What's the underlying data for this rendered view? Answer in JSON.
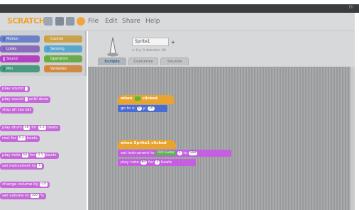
{
  "titlebar": {
    "corner_label": "Fil"
  },
  "menubar": {
    "logo": "SCRATCH",
    "menu": [
      "File",
      "Edit",
      "Share",
      "Help"
    ]
  },
  "palette": {
    "categories": [
      {
        "label": "Motion",
        "color": "#4a6cd4"
      },
      {
        "label": "Control",
        "color": "#e1a91a"
      },
      {
        "label": "Looks",
        "color": "#8a55d7"
      },
      {
        "label": "Sensing",
        "color": "#2ca5e2"
      },
      {
        "label": "Sound",
        "color": "#bb42c3"
      },
      {
        "label": "Operators",
        "color": "#5cb712"
      },
      {
        "label": "Pen",
        "color": "#0e9a6c"
      },
      {
        "label": "Variables",
        "color": "#ee7d16"
      }
    ],
    "blocks": [
      {
        "text": "play sound",
        "slot": ""
      },
      {
        "text": "play sound",
        "slot": "",
        "suffix": "until done"
      },
      {
        "text": "stop all sounds",
        "slot": null
      },
      {
        "text": "play drum",
        "slot": "48",
        "suffix": "for",
        "slot2": "0.2",
        "suffix2": "beats"
      },
      {
        "text": "rest for",
        "slot": "0.2",
        "suffix": "beats"
      },
      {
        "text": "play note",
        "slot": "60",
        "suffix": "for",
        "slot2": "0.5",
        "suffix2": "beats"
      },
      {
        "text": "set instrument to",
        "slot": "1"
      },
      {
        "text": "change volume by",
        "slot": "-10"
      },
      {
        "text": "set volume to",
        "slot": "100",
        "suffix": "%"
      }
    ]
  },
  "sprite": {
    "name": "Sprite1",
    "info": "x: 0   y: 0   direction: 90"
  },
  "tabs": [
    "Scripts",
    "Costumes",
    "Sounds"
  ],
  "scripts": {
    "script1": {
      "hat_prefix": "when",
      "hat_suffix": "clicked",
      "block_prefix": "go to x:",
      "x": "0",
      "block_mid": "y:",
      "y": "10"
    },
    "script2": {
      "hat": "when Sprite1 clicked",
      "b1_prefix": "set instrument to",
      "b1_instrument": "(10) Guitar",
      "b1_slot": "1",
      "b1_suffix": "to",
      "b1_val": "100",
      "b2_prefix": "play note",
      "b2_note": "60",
      "b2_mid": "for",
      "b2_beats": "1",
      "b2_suffix": "beats"
    }
  }
}
